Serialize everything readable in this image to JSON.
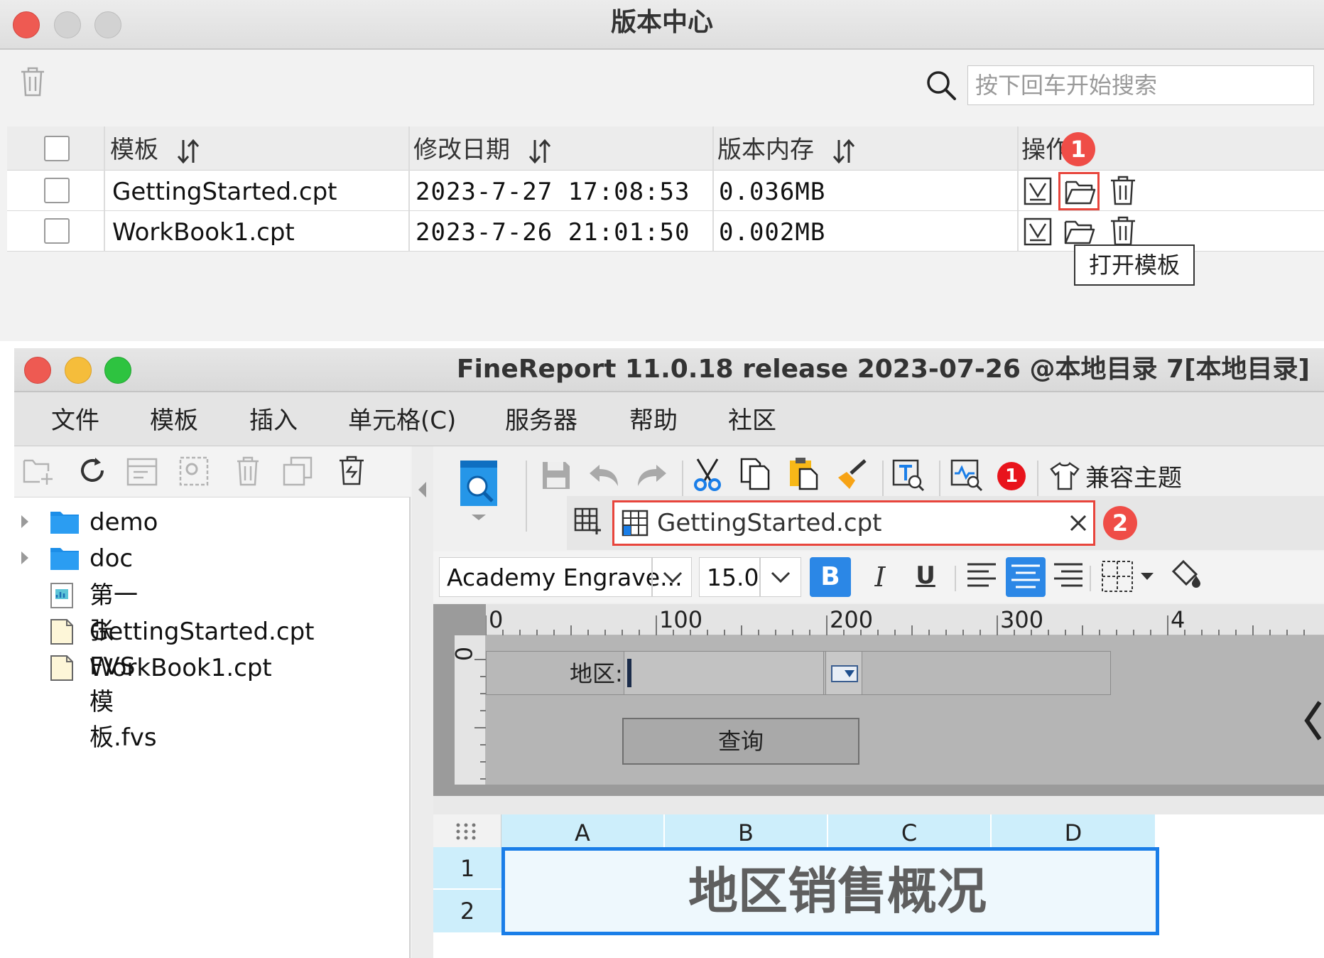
{
  "version_center": {
    "title": "版本中心",
    "search_placeholder": "按下回车开始搜索",
    "columns": [
      "模板",
      "修改日期",
      "版本内存",
      "操作"
    ],
    "rows": [
      {
        "name": "GettingStarted.cpt",
        "date": "2023-7-27 17:08:53",
        "size": "0.036MB"
      },
      {
        "name": "WorkBook1.cpt",
        "date": "2023-7-26 21:01:50",
        "size": "0.002MB"
      }
    ],
    "badge_1": "1",
    "tooltip": "打开模板"
  },
  "finereport": {
    "title": "FineReport 11.0.18 release 2023-07-26 @本地目录 7[本地目录]",
    "menu": [
      "文件",
      "模板",
      "插入",
      "单元格(C)",
      "服务器",
      "帮助",
      "社区"
    ],
    "tree": [
      {
        "label": "demo",
        "type": "folder"
      },
      {
        "label": "doc",
        "type": "folder"
      },
      {
        "label": "第一张FVS模板.fvs",
        "type": "fvs"
      },
      {
        "label": "GettingStarted.cpt",
        "type": "cpt"
      },
      {
        "label": "WorkBook1.cpt",
        "type": "cpt"
      }
    ],
    "toolbar_notification": "1",
    "theme_label": "兼容主题",
    "tab_name": "GettingStarted.cpt",
    "badge_2": "2",
    "font_name": "Academy Engrave...",
    "font_size": "15.0",
    "ruler_h": [
      "0",
      "100",
      "200",
      "300",
      "4"
    ],
    "ruler_v": "0",
    "param_label": "地区:",
    "query_button": "查询",
    "col_headers": [
      "A",
      "B",
      "C",
      "D"
    ],
    "row_headers": [
      "1",
      "2"
    ],
    "cell_title": "地区销售概况"
  },
  "colors": {
    "badge_red": "#ef4d47",
    "highlight_red": "#e8453c",
    "selection_blue": "#1a7ee8",
    "header_blue": "#cdeefb"
  }
}
